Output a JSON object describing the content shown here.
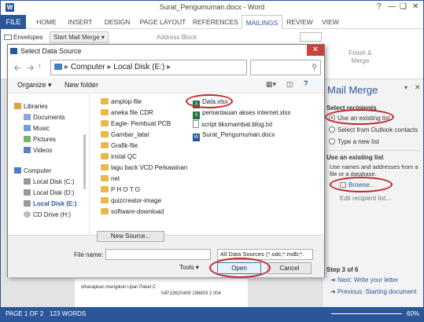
{
  "word": {
    "title": "Surat_Pengumuman.docx - Word",
    "window_controls": [
      "?",
      "—",
      "❑",
      "✕"
    ],
    "tabs": [
      "FILE",
      "HOME",
      "INSERT",
      "DESIGN",
      "PAGE LAYOUT",
      "REFERENCES",
      "MAILINGS",
      "REVIEW",
      "VIEW"
    ],
    "active_tab": "MAILINGS",
    "ribbon": {
      "envelopes": "Envelopes",
      "start_mail_merge": "Start Mail Merge",
      "address_block": "Address Block",
      "finish_merge": "Finish & Merge"
    }
  },
  "dialog": {
    "title": "Select Data Source",
    "close_glyph": "✕",
    "path": [
      "Computer",
      "Local Disk (E:)"
    ],
    "organize": "Organize",
    "new_folder": "New folder",
    "nav": {
      "libraries": "Libraries",
      "library_items": [
        "Documents",
        "Music",
        "Pictures",
        "Videos"
      ],
      "computer": "Computer",
      "drives": [
        "Local Disk (C:)",
        "Local Disk (D:)",
        "Local Disk (E:)",
        "CD Drive (H:)"
      ],
      "selected_drive": "Local Disk (E:)"
    },
    "folders": [
      "amplop-file",
      "aneka file CDR",
      "Eagle- Pembuat PCB",
      "Gambar_latar",
      "Grafik-file",
      "instal QC",
      "lagu back VCD Perkawinan",
      "net",
      "P H O T O",
      "quizcreator-image",
      "software-download"
    ],
    "files": [
      {
        "name": "Data.xlsx",
        "type": "xls"
      },
      {
        "name": "pemantauan akses internet.xlsx",
        "type": "xls"
      },
      {
        "name": "script tiksmambat.blog.txt",
        "type": "txt"
      },
      {
        "name": "Surat_Pengumuman.docx",
        "type": "docx"
      }
    ],
    "new_source": "New Source...",
    "file_name_label": "File name:",
    "file_name_value": "",
    "filter": "All Data Sources (*.odc;*.mdb;*.",
    "tools": "Tools",
    "open": "Open",
    "cancel": "Cancel"
  },
  "pane": {
    "title": "Mail Merge",
    "select_recipients": "Select recipients",
    "options": [
      "Use an existing list",
      "Select from Outlook contacts",
      "Type a new list"
    ],
    "selected_option": "Use an existing list",
    "use_existing_heading": "Use an existing list",
    "use_existing_desc": "Use names and addresses from a file or a database.",
    "browse": "Browse...",
    "edit_list": "Edit recipient list...",
    "step": "Step 3 of 6",
    "next": "Next: Write your letter",
    "prev": "Previous: Starting document"
  },
  "doc": {
    "line1": "diharapkan mengikuti Ujian Paket C",
    "line2": "NIP.19620409 198803 2 004"
  },
  "status": {
    "page": "PAGE 1 OF 2",
    "words": "123 WORDS",
    "zoom": "60%"
  },
  "colors": {
    "accent": "#2b579a",
    "annotation": "#c0272d"
  }
}
